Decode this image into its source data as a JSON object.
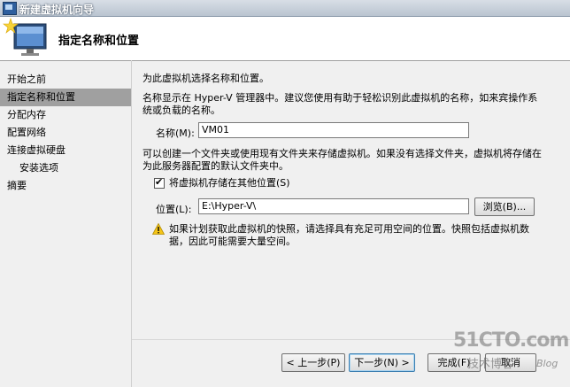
{
  "window": {
    "title": "新建虚拟机向导"
  },
  "header": {
    "title": "指定名称和位置"
  },
  "nav": {
    "items": [
      {
        "label": "开始之前",
        "active": false,
        "sub": false
      },
      {
        "label": "指定名称和位置",
        "active": true,
        "sub": false
      },
      {
        "label": "分配内存",
        "active": false,
        "sub": false
      },
      {
        "label": "配置网络",
        "active": false,
        "sub": false
      },
      {
        "label": "连接虚拟硬盘",
        "active": false,
        "sub": false
      },
      {
        "label": "安装选项",
        "active": false,
        "sub": true
      },
      {
        "label": "摘要",
        "active": false,
        "sub": false
      }
    ]
  },
  "content": {
    "intro": "为此虚拟机选择名称和位置。",
    "name_hint_line1": "名称显示在 Hyper-V 管理器中。建议您使用有助于轻松识别此虚拟机的名称，如来宾操作系",
    "name_hint_line2": "统或负载的名称。",
    "name_label": "名称(M):",
    "name_value": "VM01",
    "folder_hint_line1": "可以创建一个文件夹或使用现有文件夹来存储虚拟机。如果没有选择文件夹，虚拟机将存储在",
    "folder_hint_line2": "为此服务器配置的默认文件夹中。",
    "store_checkbox_label": "将虚拟机存储在其他位置(S)",
    "store_checked": true,
    "location_label": "位置(L):",
    "location_value": "E:\\Hyper-V\\",
    "browse_label": "浏览(B)...",
    "warning_line1": "如果计划获取此虚拟机的快照，请选择具有充足可用空间的位置。快照包括虚拟机数",
    "warning_line2": "据，因此可能需要大量空间。"
  },
  "buttons": {
    "prev": "< 上一步(P)",
    "next": "下一步(N) >",
    "finish": "完成(F)",
    "cancel": "取消"
  },
  "watermark": {
    "brand": "51CTO.com",
    "sub": "技术博客",
    "blog": "Blog"
  },
  "colors": {
    "nav_active": "#a0a0a0",
    "title_bar": "#b9c4d0",
    "warning": "#f5c518"
  }
}
